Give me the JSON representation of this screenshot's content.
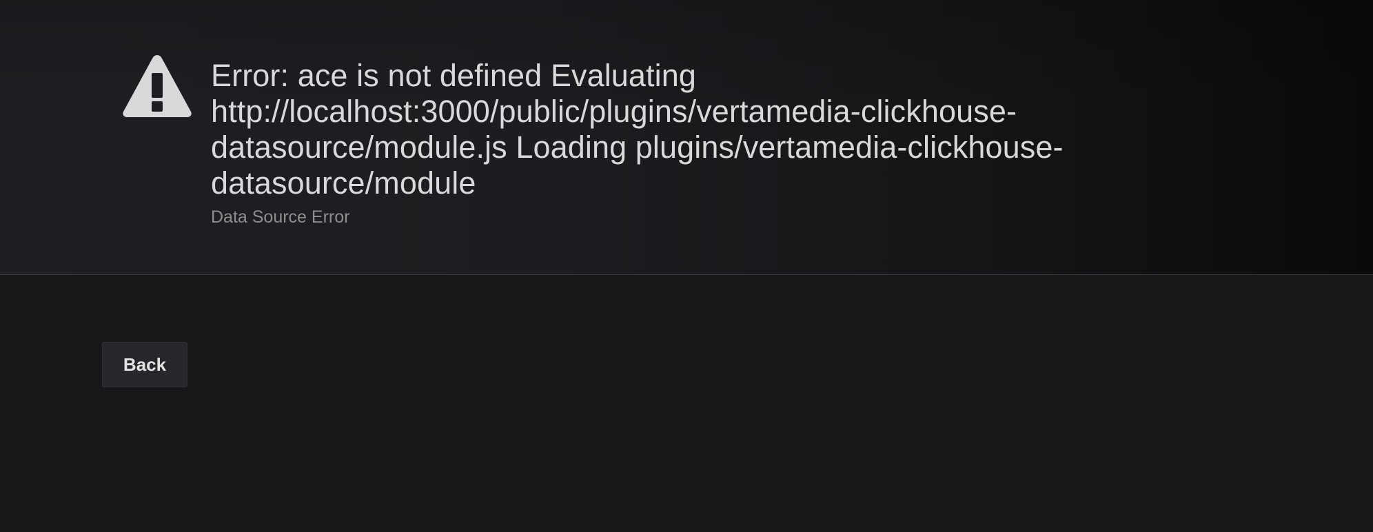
{
  "error": {
    "icon": "warning-triangle-icon",
    "title": "Error: ace is not defined Evaluating\nhttp://localhost:3000/public/plugins/vertamedia-clickhouse-\ndatasource/module.js Loading plugins/vertamedia-clickhouse-\ndatasource/module",
    "subtitle": "Data Source Error"
  },
  "actions": {
    "back_label": "Back"
  },
  "colors": {
    "background": "#161719",
    "title_text": "#d8d9da",
    "subtitle_text": "#8e8e8e",
    "button_bg": "#26272b",
    "icon_fill": "#d8d9da"
  }
}
